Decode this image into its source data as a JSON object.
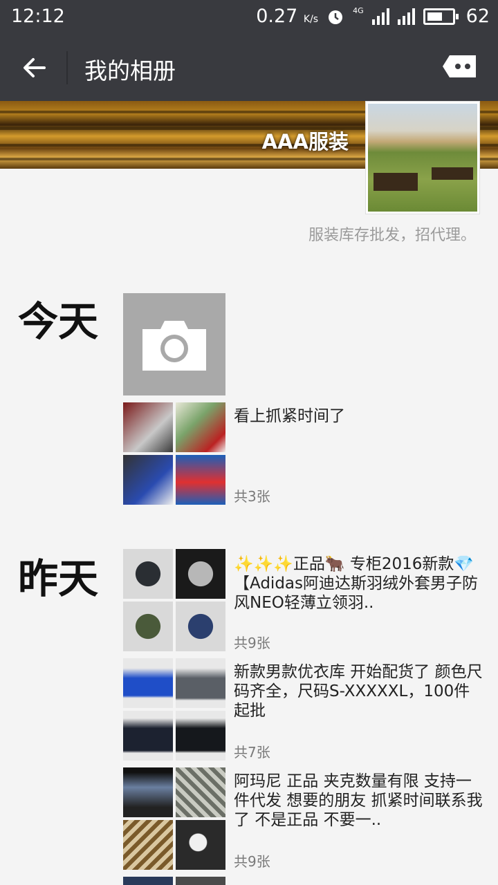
{
  "status_bar": {
    "time": "12:12",
    "net_speed": "0.27",
    "net_unit": "K/s",
    "network": "4G",
    "battery": "62",
    "battery_level": 0.62
  },
  "nav": {
    "title": "我的相册",
    "back_icon": "back-arrow-icon",
    "more_icon": "more-icon"
  },
  "profile": {
    "nickname": "AAA服装",
    "signature": "服装库存批发，招代理。"
  },
  "sections": [
    {
      "day": "今天",
      "posts": [
        {
          "text": "看上抓紧时间了",
          "count": "共3张"
        }
      ]
    },
    {
      "day": "昨天",
      "posts": [
        {
          "text": "✨✨✨正品🐂 专柜2016新款💎【Adidas阿迪达斯羽绒外套男子防风NEO轻薄立领羽..",
          "count": "共9张"
        },
        {
          "text": "新款男款优衣库 开始配货了 颜色尺码齐全，尺码S-XXXXXL，100件起批",
          "count": "共7张"
        },
        {
          "text": "阿玛尼 正品 夹克数量有限 支持一件代发 想要的朋友 抓紧时间联系我了 不是正品 不要一..",
          "count": "共9张"
        }
      ]
    }
  ],
  "colors": {
    "bar": "#393a3f",
    "background": "#f4f4f4",
    "meta_text": "#7a7a7a"
  }
}
